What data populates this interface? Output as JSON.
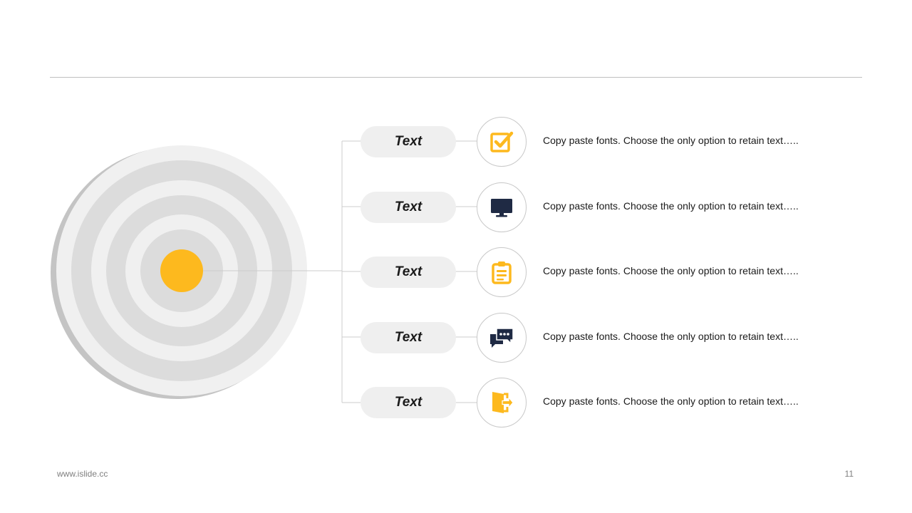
{
  "colors": {
    "accent": "#FDB91E",
    "dark": "#1F2A44",
    "ring_light": "#f0f0f0",
    "ring_dark": "#dcdcdc",
    "shadow": "#c4c4c4",
    "line": "#cccccc"
  },
  "items": [
    {
      "label": "Text",
      "icon": "checkbox-icon",
      "description": "Copy paste fonts. Choose the only option to retain text….."
    },
    {
      "label": "Text",
      "icon": "monitor-icon",
      "description": "Copy paste fonts. Choose the only option to retain text….."
    },
    {
      "label": "Text",
      "icon": "clipboard-icon",
      "description": "Copy paste fonts. Choose the only option to retain text….."
    },
    {
      "label": "Text",
      "icon": "chat-icon",
      "description": "Copy paste fonts. Choose the only option to retain text….."
    },
    {
      "label": "Text",
      "icon": "exit-door-icon",
      "description": "Copy paste fonts. Choose the only option to retain text….."
    }
  ],
  "footer": {
    "url": "www.islide.cc",
    "page": "11"
  }
}
